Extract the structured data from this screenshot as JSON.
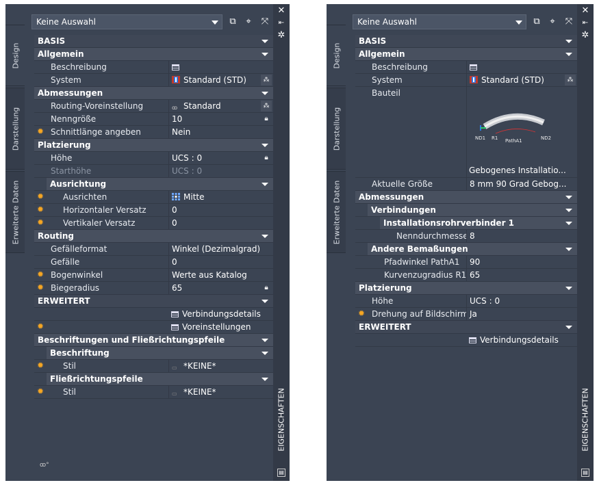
{
  "left": {
    "tabs": [
      "Design",
      "Darstellung",
      "Erweiterte Daten"
    ],
    "selector": "Keine Auswahl",
    "title": "EIGENSCHAFTEN",
    "rows": [
      {
        "t": "cat",
        "k": "BASIS"
      },
      {
        "t": "sub",
        "k": "Allgemein"
      },
      {
        "k": "Beschreibung",
        "v": "",
        "icon": "table-icon"
      },
      {
        "k": "System",
        "v": "Standard (STD)",
        "icon": "system-icon",
        "pick": true
      },
      {
        "t": "sub",
        "k": "Abmessungen"
      },
      {
        "k": "Routing-Voreinstellung",
        "v": "Standard",
        "icon": "routing-icon",
        "pick": true
      },
      {
        "k": "Nenngröße",
        "v": "10",
        "lock": true
      },
      {
        "k": "Schnittlänge angeben",
        "v": "Nein",
        "star": true
      },
      {
        "t": "sub",
        "k": "Platzierung"
      },
      {
        "k": "Höhe",
        "v": "UCS : 0",
        "lock": true
      },
      {
        "k": "Starthöhe",
        "v": "UCS : 0",
        "dim": true
      },
      {
        "t": "sub2",
        "k": "Ausrichtung"
      },
      {
        "k": "Ausrichten",
        "v": "Mitte",
        "icon": "grid-icon",
        "star": true,
        "lvl": 2
      },
      {
        "k": "Horizontaler Versatz",
        "v": "0",
        "star": true,
        "lvl": 2
      },
      {
        "k": "Vertikaler Versatz",
        "v": "0",
        "star": true,
        "lvl": 2
      },
      {
        "t": "sub",
        "k": "Routing"
      },
      {
        "k": "Gefälleformat",
        "v": "Winkel (Dezimalgrad)"
      },
      {
        "k": "Gefälle",
        "v": "0"
      },
      {
        "k": "Bogenwinkel",
        "v": "Werte aus Katalog",
        "star": true
      },
      {
        "k": "Biegeradius",
        "v": "65",
        "star": true,
        "lock": true
      },
      {
        "t": "cat",
        "k": "ERWEITERT"
      },
      {
        "k": "",
        "v": "Verbindungsdetails",
        "icon": "table-icon",
        "right": true
      },
      {
        "k": "",
        "v": "Voreinstellungen",
        "icon": "table-icon",
        "right": true,
        "star": true
      },
      {
        "t": "sub",
        "k": "Beschriftungen und Fließrichtungspfeile"
      },
      {
        "t": "sub2",
        "k": "Beschriftung"
      },
      {
        "k": "Stil",
        "v": "*KEINE*",
        "star": true,
        "icon": "style-icon",
        "lvl": 2
      },
      {
        "t": "sub2",
        "k": "Fließrichtungspfeile"
      },
      {
        "k": "Stil",
        "v": "*KEINE*",
        "star": true,
        "icon": "style-icon",
        "lvl": 2
      }
    ]
  },
  "right": {
    "tabs": [
      "Design",
      "Darstellung",
      "Erweiterte Daten"
    ],
    "selector": "Keine Auswahl",
    "title": "EIGENSCHAFTEN",
    "preview_caption": "Gebogenes Installatio...",
    "preview_labels": [
      "ND1",
      "R1",
      "PathA1",
      "ND2"
    ],
    "rows": [
      {
        "t": "cat",
        "k": "BASIS"
      },
      {
        "t": "sub",
        "k": "Allgemein"
      },
      {
        "k": "Beschreibung",
        "v": "",
        "icon": "table-icon"
      },
      {
        "k": "System",
        "v": "Standard (STD)",
        "icon": "system-icon",
        "pick": true
      },
      {
        "k": "Bauteil",
        "v": "",
        "preview": true
      },
      {
        "k": "Aktuelle Größe",
        "v": "8 mm 90 Grad Gebog..."
      },
      {
        "t": "sub",
        "k": "Abmessungen"
      },
      {
        "t": "sub2",
        "k": "Verbindungen"
      },
      {
        "t": "sub3",
        "k": "Installationsrohrverbinder 1"
      },
      {
        "k": "Nenndurchmesser",
        "v": "8",
        "lvl": 3
      },
      {
        "t": "sub2",
        "k": "Andere Bemaßungen"
      },
      {
        "k": "Pfadwinkel PathA1",
        "v": "90",
        "lvl": 2
      },
      {
        "k": "Kurvenzugradius R1",
        "v": "65",
        "lvl": 2
      },
      {
        "t": "sub",
        "k": "Platzierung"
      },
      {
        "k": "Höhe",
        "v": "UCS : 0"
      },
      {
        "k": "Drehung auf Bildschirm a...",
        "v": "Ja",
        "star": true
      },
      {
        "t": "cat",
        "k": "ERWEITERT"
      },
      {
        "k": "",
        "v": "Verbindungsdetails",
        "icon": "table-icon",
        "right": true
      }
    ]
  }
}
